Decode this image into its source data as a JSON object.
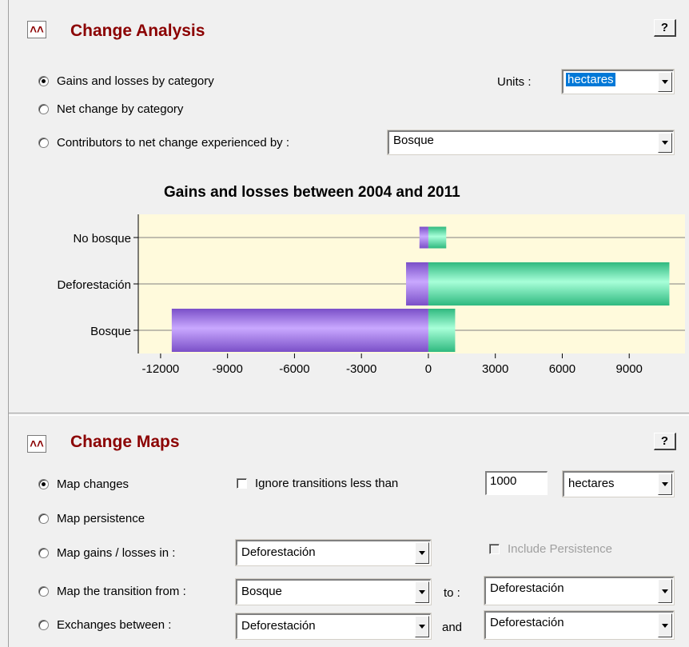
{
  "change_analysis": {
    "title": "Change Analysis",
    "help_label": "?",
    "options": [
      {
        "label": "Gains and losses by category",
        "selected": true
      },
      {
        "label": "Net change by category",
        "selected": false
      },
      {
        "label": "Contributors to net change experienced by :",
        "selected": false
      }
    ],
    "units_label": "Units :",
    "units_value": "hectares",
    "contributor_value": "Bosque"
  },
  "chart_data": {
    "type": "bar",
    "orientation": "horizontal",
    "title": "Gains and losses between 2004 and 2011",
    "categories": [
      "No bosque",
      "Deforestación",
      "Bosque"
    ],
    "series": [
      {
        "values": [
          -400,
          -1000,
          -11500
        ],
        "color": "#9b6fe0"
      },
      {
        "values": [
          800,
          10800,
          1200
        ],
        "color": "#5de0a6"
      }
    ],
    "xlim": [
      -13000,
      11500
    ],
    "xticks": [
      -12000,
      -9000,
      -6000,
      -3000,
      0,
      3000,
      6000,
      9000
    ],
    "background": "#fffadc"
  },
  "change_maps": {
    "title": "Change Maps",
    "help_label": "?",
    "options": [
      {
        "label": "Map changes",
        "selected": true
      },
      {
        "label": "Map persistence",
        "selected": false
      },
      {
        "label": "Map gains / losses in :",
        "selected": false
      },
      {
        "label": "Map the transition from :",
        "selected": false
      },
      {
        "label": "Exchanges between :",
        "selected": false
      }
    ],
    "ignore_label": "Ignore transitions less than",
    "ignore_checked": false,
    "threshold_value": "1000",
    "threshold_units": "hectares",
    "gains_losses_value": "Deforestación",
    "include_persistence_label": "Include Persistence",
    "transition_from": "Bosque",
    "to_label": "to :",
    "transition_to": "Deforestación",
    "exchange_a": "Deforestación",
    "and_label": "and",
    "exchange_b": "Deforestación"
  }
}
